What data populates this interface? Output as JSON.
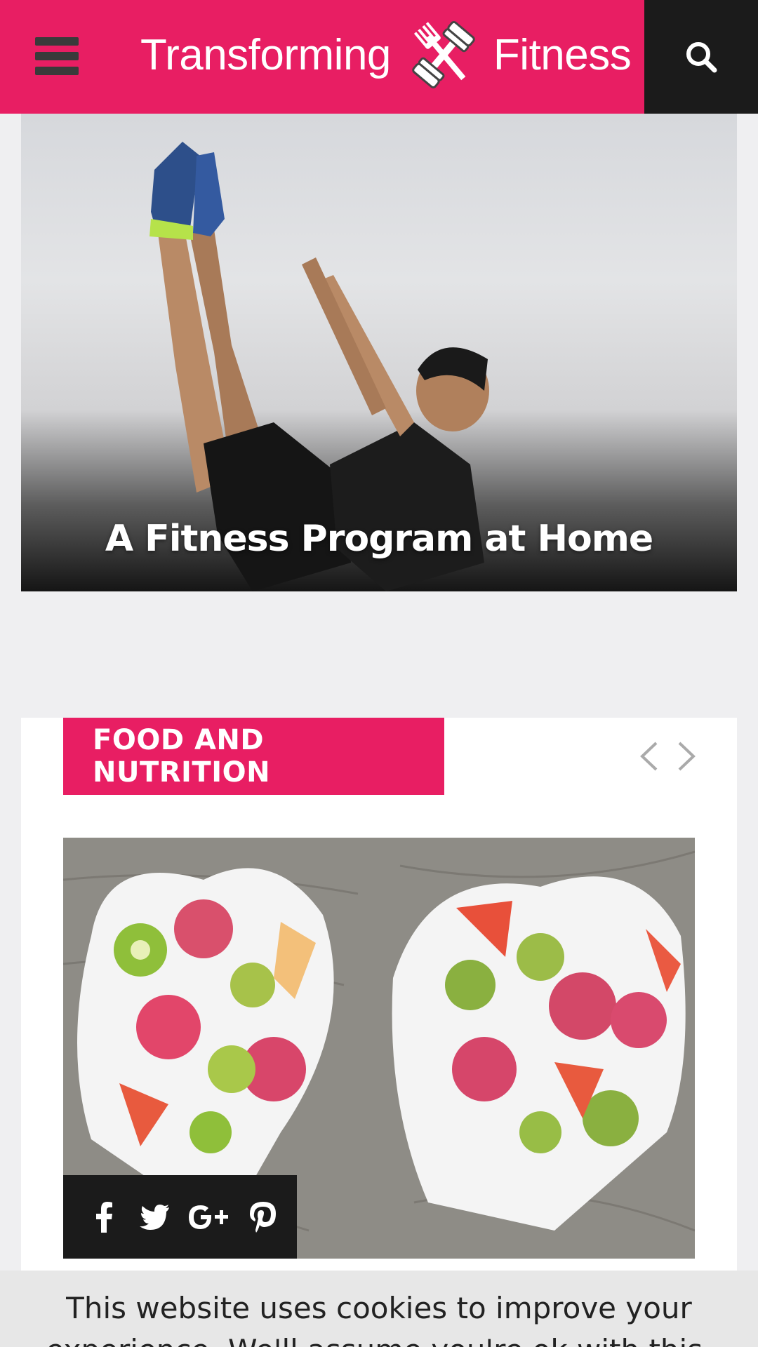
{
  "header": {
    "logo_left": "Transforming",
    "logo_right": "Fitness",
    "accent_color": "#e81e63",
    "menu_icon": "hamburger-menu-icon",
    "search_icon": "search-icon"
  },
  "hero": {
    "title": "A Fitness Program at Home"
  },
  "category_section": {
    "label": "FOOD AND NUTRITION",
    "prev_icon": "chevron-left-icon",
    "next_icon": "chevron-right-icon",
    "share_icons": [
      "facebook-icon",
      "twitter-icon",
      "google-plus-icon",
      "pinterest-icon"
    ]
  },
  "cookie_notice": {
    "text": "This website uses cookies to improve your experience. We'll assume you're ok with this, but"
  }
}
